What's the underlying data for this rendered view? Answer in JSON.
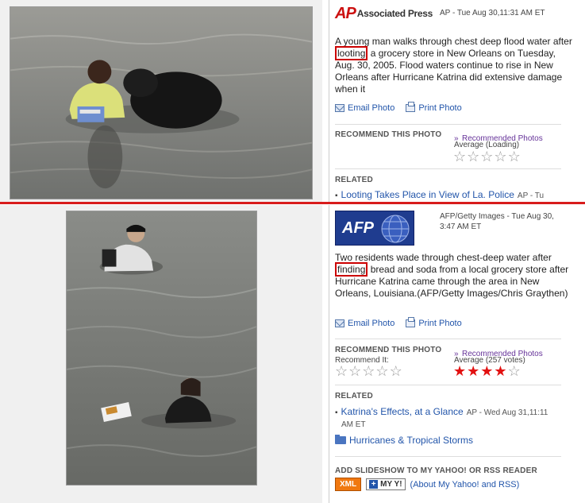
{
  "top": {
    "source_logo": {
      "mark": "AP",
      "name": "Associated Press"
    },
    "source_line": "AP - Tue Aug 30,11:31 AM ET",
    "caption": {
      "before": "A young man walks through chest deep flood water after ",
      "highlight": "looting",
      "after": " a grocery store in New Orleans on Tuesday, Aug. 30, 2005. Flood waters continue to rise in New Orleans after Hurricane Katrina did extensive damage when it"
    },
    "email_label": "Email Photo",
    "print_label": "Print Photo",
    "recommend_heading": "RECOMMEND THIS PHOTO",
    "recommended_link": "Recommended Photos",
    "average_label": "Average (Loading)",
    "stars_filled": 0,
    "stars_total": 5,
    "related_heading": "RELATED",
    "related_items": [
      {
        "title": "Looting Takes Place in View of La. Police",
        "meta": "AP - Tu"
      }
    ]
  },
  "bottom": {
    "source_logo": {
      "mark": "AFP"
    },
    "source_line_1": "AFP/Getty Images - Tue Aug 30,",
    "source_line_2": "3:47 AM ET",
    "caption": {
      "before": "Two residents wade through chest-deep water after ",
      "highlight": "finding",
      "after": " bread and soda from a local grocery store after Hurricane Katrina came through the area in New Orleans, Louisiana.(AFP/Getty Images/Chris Graythen)"
    },
    "email_label": "Email Photo",
    "print_label": "Print Photo",
    "recommend_heading": "RECOMMEND THIS PHOTO",
    "recommended_link": "Recommended Photos",
    "recommend_it_label": "Recommend It:",
    "average_label": "Average (257 votes)",
    "recommend_stars_total": 5,
    "average_stars_filled": 4,
    "average_stars_total": 5,
    "related_heading": "RELATED",
    "related_items": [
      {
        "title": "Katrina's Effects, at a Glance",
        "meta": "AP - Wed Aug 31,11:11",
        "meta2": "AM ET"
      }
    ],
    "slideshow_link": "Hurricanes & Tropical Storms",
    "add_heading": "ADD SLIDESHOW TO MY YAHOO! OR RSS READER",
    "xml_button": "XML",
    "myyahoo_button": "MY Y!",
    "about_link": "(About My Yahoo! and RSS)"
  },
  "colors": {
    "divider": "#d81c1c",
    "highlight_box": "#cc0000",
    "link": "#2255aa",
    "star_filled": "#e21111"
  }
}
